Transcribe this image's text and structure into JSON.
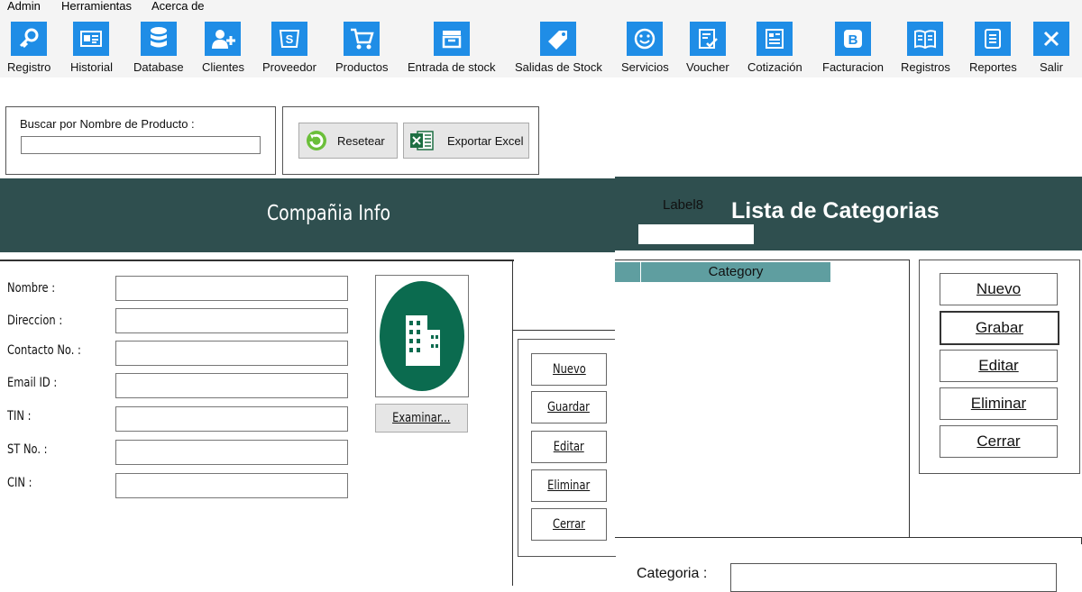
{
  "menu": [
    "Admin",
    "Herramientas",
    "Acerca de"
  ],
  "toolbar": [
    {
      "label": "Registro",
      "icon": "key-icon"
    },
    {
      "label": "Historial",
      "icon": "id-card-icon"
    },
    {
      "label": "Database",
      "icon": "database-icon"
    },
    {
      "label": "Clientes",
      "icon": "add-user-icon"
    },
    {
      "label": "Proveedor",
      "icon": "supplier-icon"
    },
    {
      "label": "Productos",
      "icon": "cart-icon"
    },
    {
      "label": "Entrada de stock",
      "icon": "inbox-icon"
    },
    {
      "label": "Salidas de Stock",
      "icon": "tag-icon"
    },
    {
      "label": "Servicios",
      "icon": "smile-icon"
    },
    {
      "label": "Voucher",
      "icon": "checklist-icon"
    },
    {
      "label": "Cotización",
      "icon": "document-icon"
    },
    {
      "label": "Facturacion",
      "icon": "b-icon"
    },
    {
      "label": "Registros",
      "icon": "book-icon"
    },
    {
      "label": "Reportes",
      "icon": "list-icon"
    },
    {
      "label": "Salir",
      "icon": "close-icon"
    }
  ],
  "search": {
    "label": "Buscar por Nombre de Producto :",
    "value": ""
  },
  "actions": {
    "reset_label": "Resetear",
    "export_label": "Exportar Excel"
  },
  "company": {
    "title": "Compañia Info",
    "fields": [
      {
        "label": "Nombre :",
        "value": ""
      },
      {
        "label": "Direccion :",
        "value": ""
      },
      {
        "label": "Contacto No. :",
        "value": ""
      },
      {
        "label": "Email ID :",
        "value": ""
      },
      {
        "label": "TIN :",
        "value": ""
      },
      {
        "label": "ST No. :",
        "value": ""
      },
      {
        "label": "CIN :",
        "value": ""
      }
    ],
    "browse_label": "Examinar...",
    "buttons": [
      "Nuevo",
      "Guardar",
      "Editar",
      "Eliminar",
      "Cerrar"
    ]
  },
  "category": {
    "label8": "Label8",
    "title": "Lista de Categorias",
    "column": "Category",
    "buttons": [
      "Nuevo",
      "Grabar",
      "Editar",
      "Eliminar",
      "Cerrar"
    ],
    "field_label": "Categoria :",
    "field_value": ""
  },
  "colors": {
    "accent": "#1f8de6",
    "banner": "#2f4f4f",
    "header_cell": "#5f9ea0",
    "logo_circle": "#0b6b4f"
  }
}
